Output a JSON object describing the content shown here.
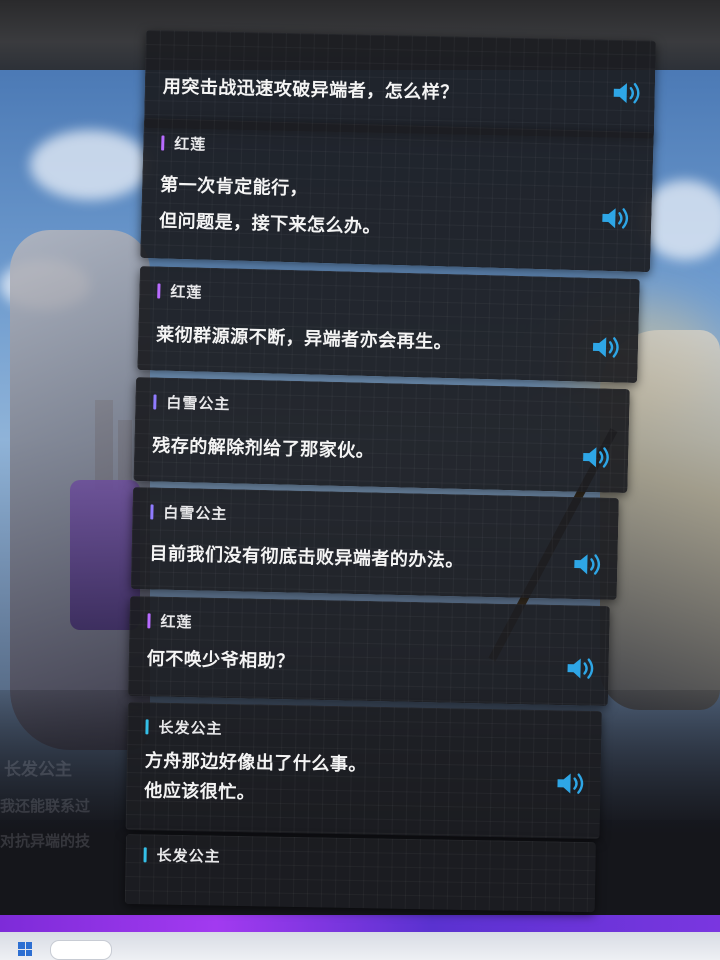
{
  "colors": {
    "voice_icon": "#2ea6e6",
    "accent_honglian": "#b86bff",
    "accent_baixue": "#8f7bff",
    "accent_changfa": "#34c0e8",
    "taskbar_accent": "#8a2be2"
  },
  "background": {
    "ghost_lines": [
      "长发公主",
      "我还能联系过",
      "对抗异端的技"
    ]
  },
  "dialog": {
    "entries": [
      {
        "speaker": "",
        "accent": "accent_honglian",
        "lines": [
          "用突击战迅速攻破异端者，怎么样？"
        ],
        "voice_icon": "speaker-volume-icon"
      },
      {
        "speaker": "红莲",
        "accent": "accent_honglian",
        "lines": [
          "第一次肯定能行，",
          "但问题是，接下来怎么办。"
        ],
        "voice_icon": "speaker-volume-icon"
      },
      {
        "speaker": "红莲",
        "accent": "accent_honglian",
        "lines": [
          "莱彻群源源不断，异端者亦会再生。"
        ],
        "voice_icon": "speaker-volume-icon"
      },
      {
        "speaker": "白雪公主",
        "accent": "accent_baixue",
        "lines": [
          "残存的解除剂给了那家伙。"
        ],
        "voice_icon": "speaker-volume-icon"
      },
      {
        "speaker": "白雪公主",
        "accent": "accent_baixue",
        "lines": [
          "目前我们没有彻底击败异端者的办法。"
        ],
        "voice_icon": "speaker-volume-icon"
      },
      {
        "speaker": "红莲",
        "accent": "accent_honglian",
        "lines": [
          "何不唤少爷相助？"
        ],
        "voice_icon": "speaker-volume-icon"
      },
      {
        "speaker": "长发公主",
        "accent": "accent_changfa",
        "lines": [
          "方舟那边好像出了什么事。",
          "他应该很忙。"
        ],
        "voice_icon": "speaker-volume-icon"
      },
      {
        "speaker": "长发公主",
        "accent": "accent_changfa",
        "lines": [],
        "voice_icon": ""
      }
    ]
  }
}
